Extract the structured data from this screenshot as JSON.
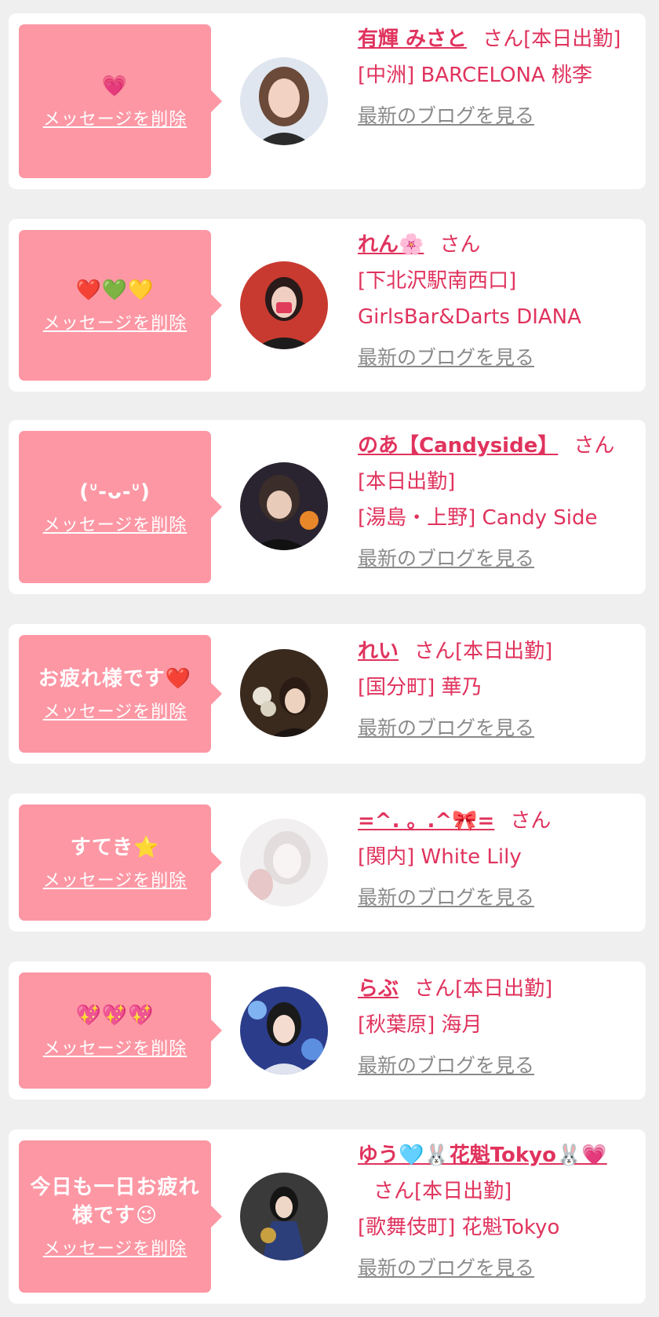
{
  "delete_label": "メッセージを削除",
  "blog_label": "最新のブログを見る",
  "san": "さん",
  "colors": {
    "accent": "#e0335d",
    "bubble": "#fd97a4",
    "background": "#efefef",
    "link_gray": "#8a8a8a"
  },
  "items": [
    {
      "message": "💗",
      "name": "有輝 みさと",
      "status": "[本日出勤]",
      "shop": "[中洲] BARCELONA 桃李"
    },
    {
      "message": "❤️💚💛",
      "name": "れん🌸",
      "status": "",
      "shop": "[下北沢駅南西口] GirlsBar&Darts DIANA"
    },
    {
      "message": "(ᐡ-ᴗ-ᐡ)",
      "name": "のあ【Candyside】",
      "status": "[本日出勤]",
      "shop": "[湯島・上野] Candy Side"
    },
    {
      "message": "お疲れ様です❤️",
      "name": "れい",
      "status": "[本日出勤]",
      "shop": "[国分町] 華乃"
    },
    {
      "message": "すてき⭐",
      "name": "=^. 。.^🎀=",
      "status": "",
      "shop": "[関内] White Lily"
    },
    {
      "message": "💖💖💖",
      "name": "らぶ",
      "status": "[本日出勤]",
      "shop": "[秋葉原] 海月"
    },
    {
      "message": "今日も一日お疲れ様です😉",
      "name": "ゆう🩵🐰花魁Tokyo🐰💗",
      "status": "[本日出勤]",
      "shop": "[歌舞伎町] 花魁Tokyo"
    }
  ]
}
